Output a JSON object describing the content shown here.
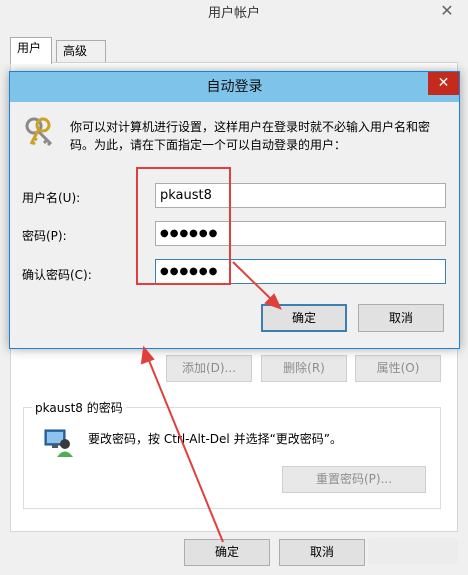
{
  "parent": {
    "title": "用户帐户",
    "close_glyph": "✕",
    "tabs": [
      "用户",
      "高级"
    ],
    "buttons": {
      "add": "添加(D)...",
      "remove": "删除(R)",
      "properties": "属性(O)"
    },
    "password_group": {
      "title": "pkaust8 的密码",
      "text": "要改密码，按 Ctrl-Alt-Del 并选择“更改密码”。",
      "reset_button": "重置密码(P)..."
    },
    "ok": "确定",
    "cancel": "取消"
  },
  "dialog": {
    "title": "自动登录",
    "close_glyph": "✕",
    "description": "你可以对计算机进行设置，这样用户在登录时就不必输入用户名和密码。为此，请在下面指定一个可以自动登录的用户：",
    "fields": {
      "username_label": "用户名(U):",
      "username_value": "pkaust8",
      "password_label": "密码(P):",
      "password_value": "●●●●●●",
      "confirm_label": "确认密码(C):",
      "confirm_value": "●●●●●●"
    },
    "ok": "确定",
    "cancel": "取消"
  },
  "colors": {
    "annotation": "#e0403c",
    "titlebar": "#7ec3ea",
    "close": "#c42b1c",
    "focus": "#3c7fb1"
  },
  "icons": [
    "keys-icon",
    "user-monitor-icon",
    "close-icon"
  ]
}
